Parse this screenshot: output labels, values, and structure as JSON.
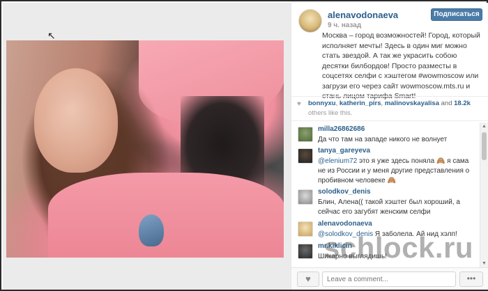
{
  "post": {
    "username": "alenavodonaeva",
    "time": "9 ч. назад",
    "follow_label": "Подписаться",
    "caption": "Москва – город возможностей! Город, который исполняет мечты! Здесь в один миг можно стать звездой. А так же украсить собою десятки билбордов! Просто разместы в соцсетях селфи с хэштегом #wowmoscow или загрузи его через сайт wowmoscow.mts.ru и стань лицом тарифа Smart!"
  },
  "likes": {
    "likers": [
      "bonnyxu",
      "katherin_pirs",
      "malinovskayalisa"
    ],
    "and_text": "and",
    "count": "18.2k",
    "others_text": "others like this."
  },
  "comments": [
    {
      "user": "milla26862686",
      "mention": "",
      "text": "Да что там на западе никого не волнует"
    },
    {
      "user": "tanya_gareyeva",
      "mention": "@elenium72",
      "text": " это я уже здесь поняла 🙈 я сама не из России и у меня другие представления о пробивном человеке 🙈"
    },
    {
      "user": "solodkov_denis",
      "mention": "",
      "text": "Блин, Алена(( такой хэштег был хороший, а сейчас его загубят женским селфи"
    },
    {
      "user": "alenavodonaeva",
      "mention": "@solodkov_denis",
      "text": " Я заболела. Ай нид хэлп!"
    },
    {
      "user": "mr.kiklicin",
      "mention": "",
      "text": "Шикарно выглядишь!"
    }
  ],
  "footer": {
    "comment_placeholder": "Leave a comment...",
    "more_label": "•••"
  },
  "icons": {
    "heart": "heart-icon",
    "cursor": "cursor-icon"
  },
  "watermark": "schlock.ru"
}
